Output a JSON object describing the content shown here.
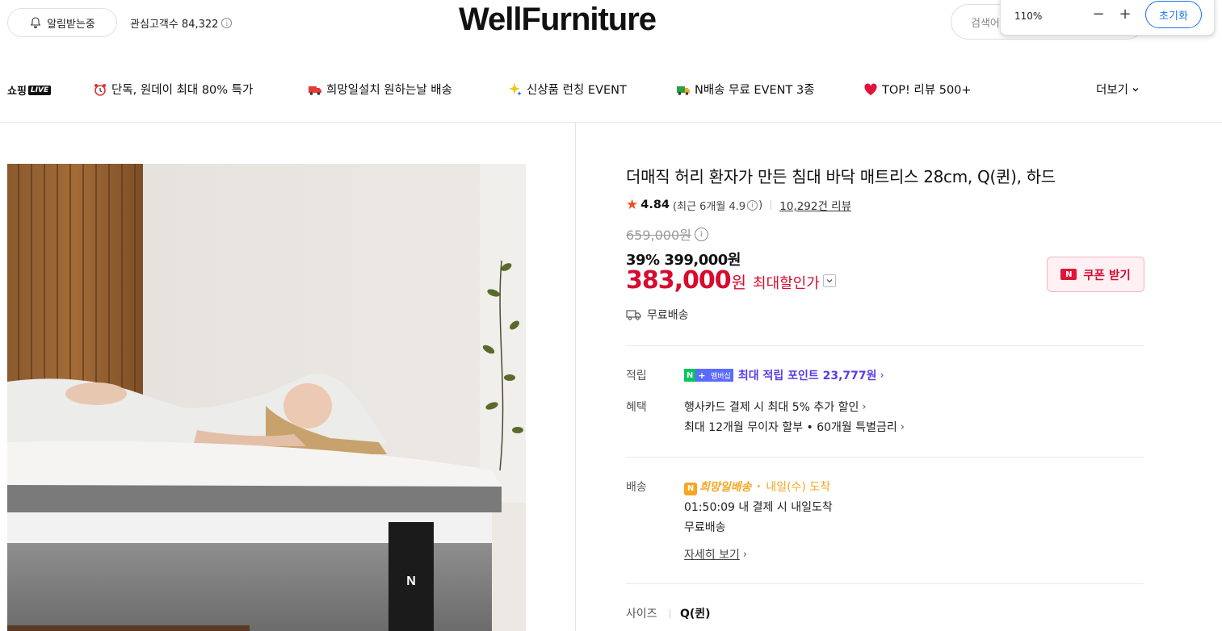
{
  "header": {
    "notify_label": "알림받는중",
    "interest_label": "관심고객수 84,322",
    "logo": "WellFurniture",
    "search_placeholder": "검색어"
  },
  "zoom": {
    "level": "110%",
    "minus": "−",
    "plus": "+",
    "reset": "초기화"
  },
  "nav": {
    "shopping": "쇼핑",
    "live": "LIVE",
    "items": [
      {
        "label": "단독, 원데이 최대 80% 특가",
        "icon": "alarm-clock-icon"
      },
      {
        "label": "희망일설치 원하는날 배송",
        "icon": "truck-icon"
      },
      {
        "label": "신상품 런칭 EVENT",
        "icon": "sparkle-icon"
      },
      {
        "label": "N배송 무료 EVENT 3종",
        "icon": "delivery-truck-icon"
      },
      {
        "label": "TOP! 리뷰 500+",
        "icon": "heart-icon"
      }
    ],
    "more": "더보기"
  },
  "product": {
    "title": "더매직 허리 환자가 만든 침대 바닥 매트리스 28cm, Q(퀸), 하드",
    "rating": "4.84",
    "recent_rating": "(최근 6개월 4.9",
    "recent_rating_close": ")",
    "reviews": "10,292건 리뷰",
    "original_price": "659,000원",
    "discount_line": "39% 399,000원",
    "max_price": "383,000",
    "max_won": "원",
    "max_label": "최대할인가",
    "coupon_label": "쿠폰 받기",
    "free_shipping": "무료배송"
  },
  "points": {
    "label": "적립",
    "badge_n": "N",
    "badge_plus": "+",
    "badge_member": "멤버십",
    "text": "최대 적립 포인트 23,777원"
  },
  "benefits": {
    "label": "혜택",
    "line1": "행사카드 결제 시 최대 5% 추가 할인",
    "line2": "최대 12개월 무이자 할부 • 60개월 특별금리"
  },
  "delivery": {
    "label": "배송",
    "hope": "희망일배송",
    "arrival": "내일(수) 도착",
    "countdown": "01:50:09  내 결제 시 내일도착",
    "fee": "무료배송",
    "detail": "자세히 보기"
  },
  "size": {
    "label": "사이즈",
    "value": "Q(퀸)"
  }
}
